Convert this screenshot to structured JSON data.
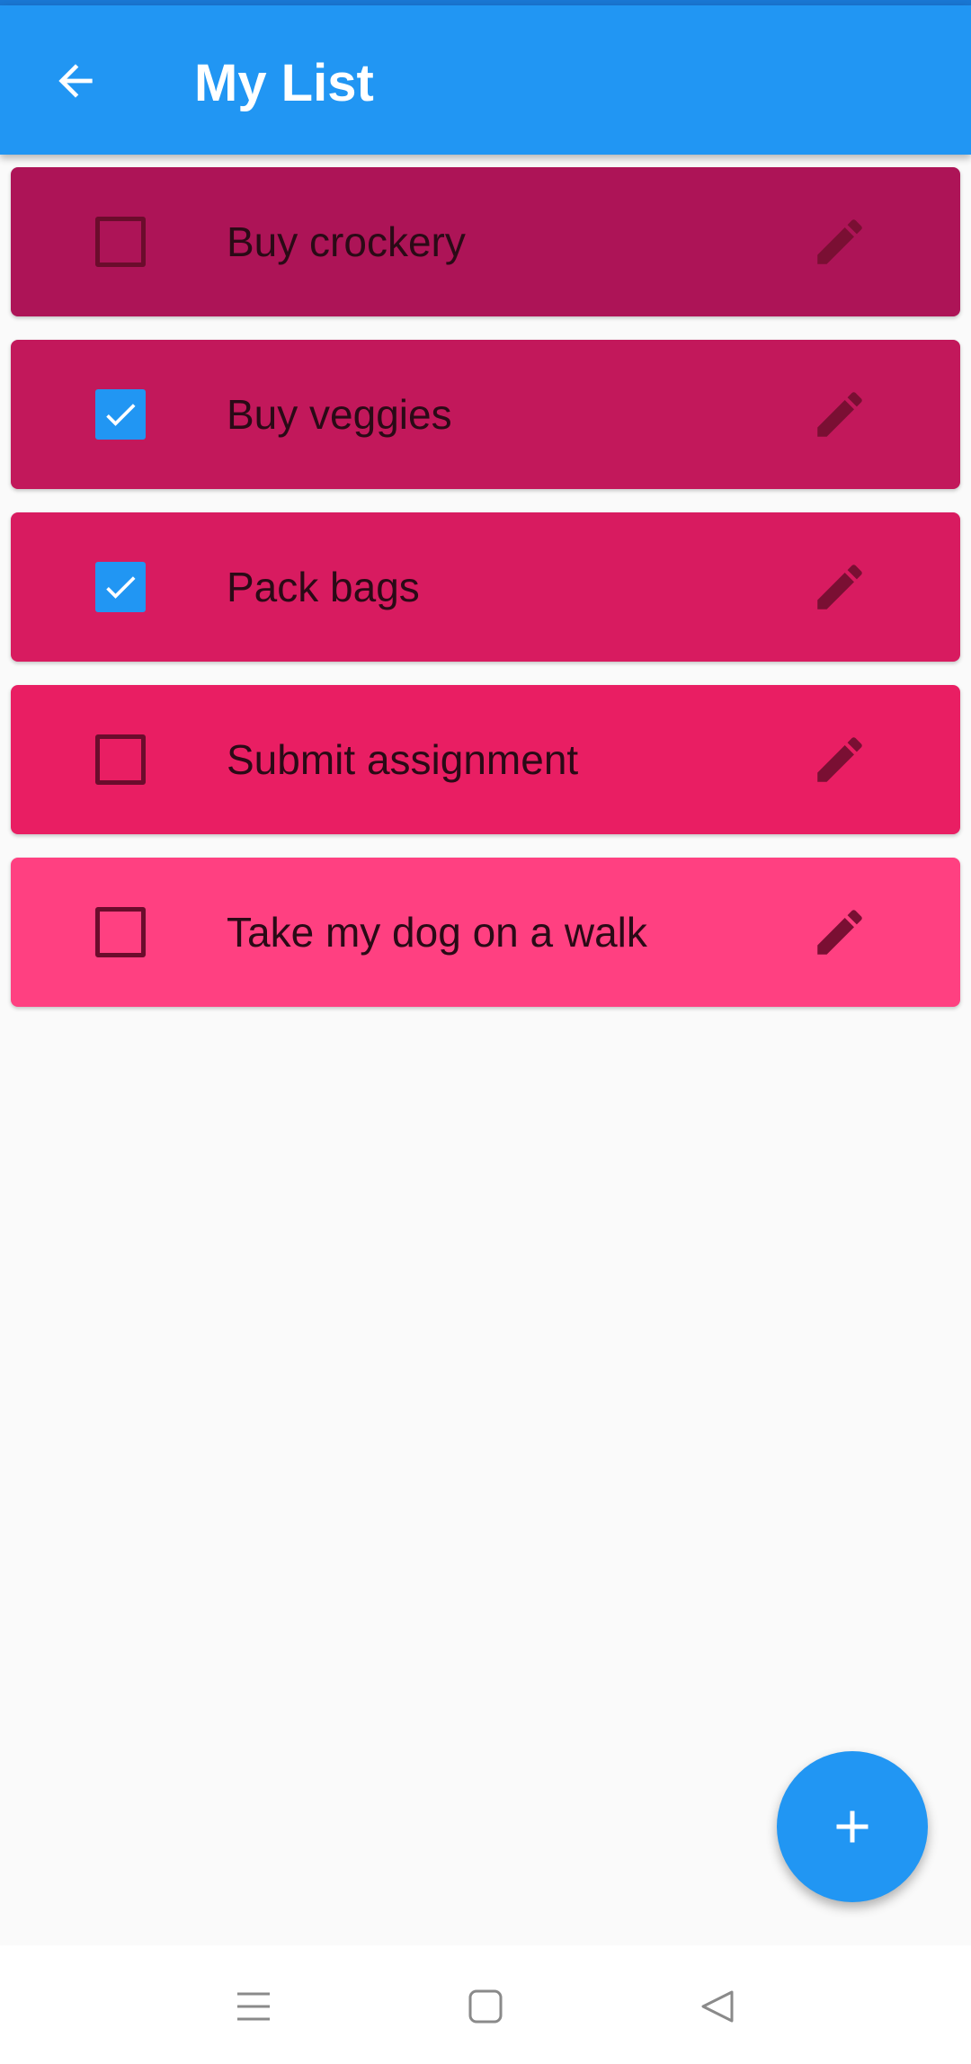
{
  "app_bar": {
    "title": "My List",
    "back_icon": "arrow-left-icon"
  },
  "tasks": [
    {
      "label": "Buy crockery",
      "checked": false,
      "color": "#ad1457"
    },
    {
      "label": "Buy veggies",
      "checked": true,
      "color": "#c2185b"
    },
    {
      "label": "Pack bags",
      "checked": true,
      "color": "#d81b60"
    },
    {
      "label": "Submit assignment",
      "checked": false,
      "color": "#e91e63"
    },
    {
      "label": "Take my dog on a walk",
      "checked": false,
      "color": "#ff4081"
    }
  ],
  "fab": {
    "icon": "plus-icon"
  },
  "nav": {
    "icons": [
      "menu-icon",
      "home-square-icon",
      "back-triangle-icon"
    ]
  },
  "colors": {
    "primary": "#2196f3",
    "background": "#fafafa",
    "edit_icon": "#7a0f33"
  }
}
